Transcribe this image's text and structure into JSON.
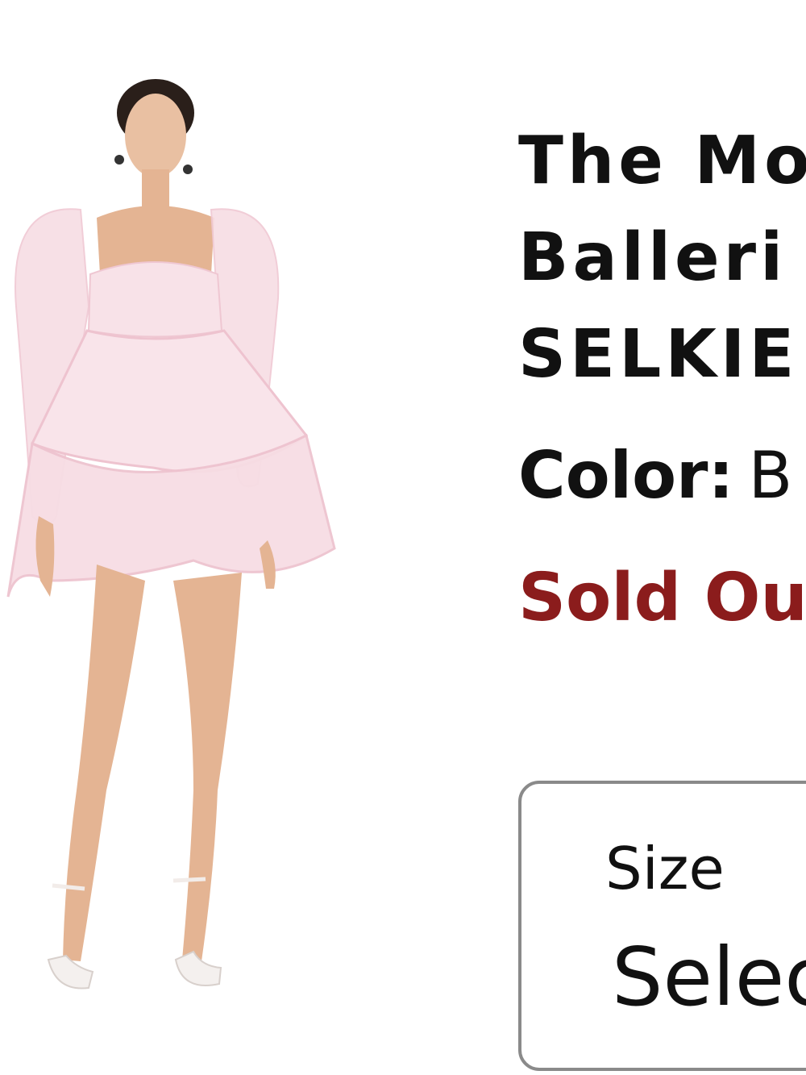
{
  "product": {
    "title_lines": [
      "The Mo",
      "Balleri",
      "SELKIE"
    ],
    "color_label": "Color:",
    "color_value": "B",
    "stock_status": "Sold Ou",
    "image": {
      "description_icon": "product-photo",
      "dress_color": "#f7dde4",
      "skin_color": "#e7b99a",
      "hair_color": "#2a1f1a"
    }
  },
  "size_selector": {
    "label": "Size",
    "value": "Selec"
  },
  "colors": {
    "text": "#111111",
    "sold_out": "#8b1c1c",
    "border": "#8a8a8a"
  }
}
